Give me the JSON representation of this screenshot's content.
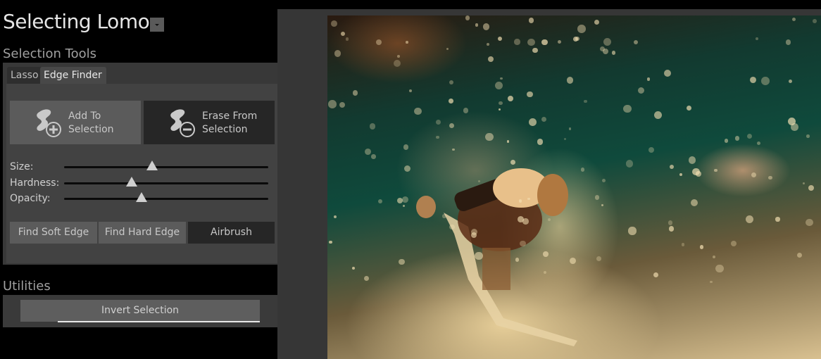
{
  "header": {
    "title": "Selecting Lomo",
    "dropdown_icon": "chevron-down-icon"
  },
  "selection_tools": {
    "heading": "Selection Tools",
    "tabs": [
      {
        "label": "Lasso",
        "active": false
      },
      {
        "label": "Edge Finder",
        "active": true
      }
    ],
    "modes": [
      {
        "label_line1": "Add To",
        "label_line2": "Selection",
        "icon": "brush-add-icon",
        "active": true
      },
      {
        "label_line1": "Erase From",
        "label_line2": "Selection",
        "icon": "brush-erase-icon",
        "active": false
      }
    ],
    "sliders": [
      {
        "label": "Size:",
        "value": 0.43
      },
      {
        "label": "Hardness:",
        "value": 0.33
      },
      {
        "label": "Opacity:",
        "value": 0.38
      }
    ],
    "edge_buttons": [
      {
        "label": "Find Soft Edge",
        "active": false
      },
      {
        "label": "Find Hard Edge",
        "active": false
      },
      {
        "label": "Airbrush",
        "active": true
      }
    ]
  },
  "utilities": {
    "heading": "Utilities",
    "invert_label": "Invert Selection"
  },
  "canvas": {
    "image_description": "Snowboarder mid-air jump with snow spray, teal sky, lomo effect"
  }
}
